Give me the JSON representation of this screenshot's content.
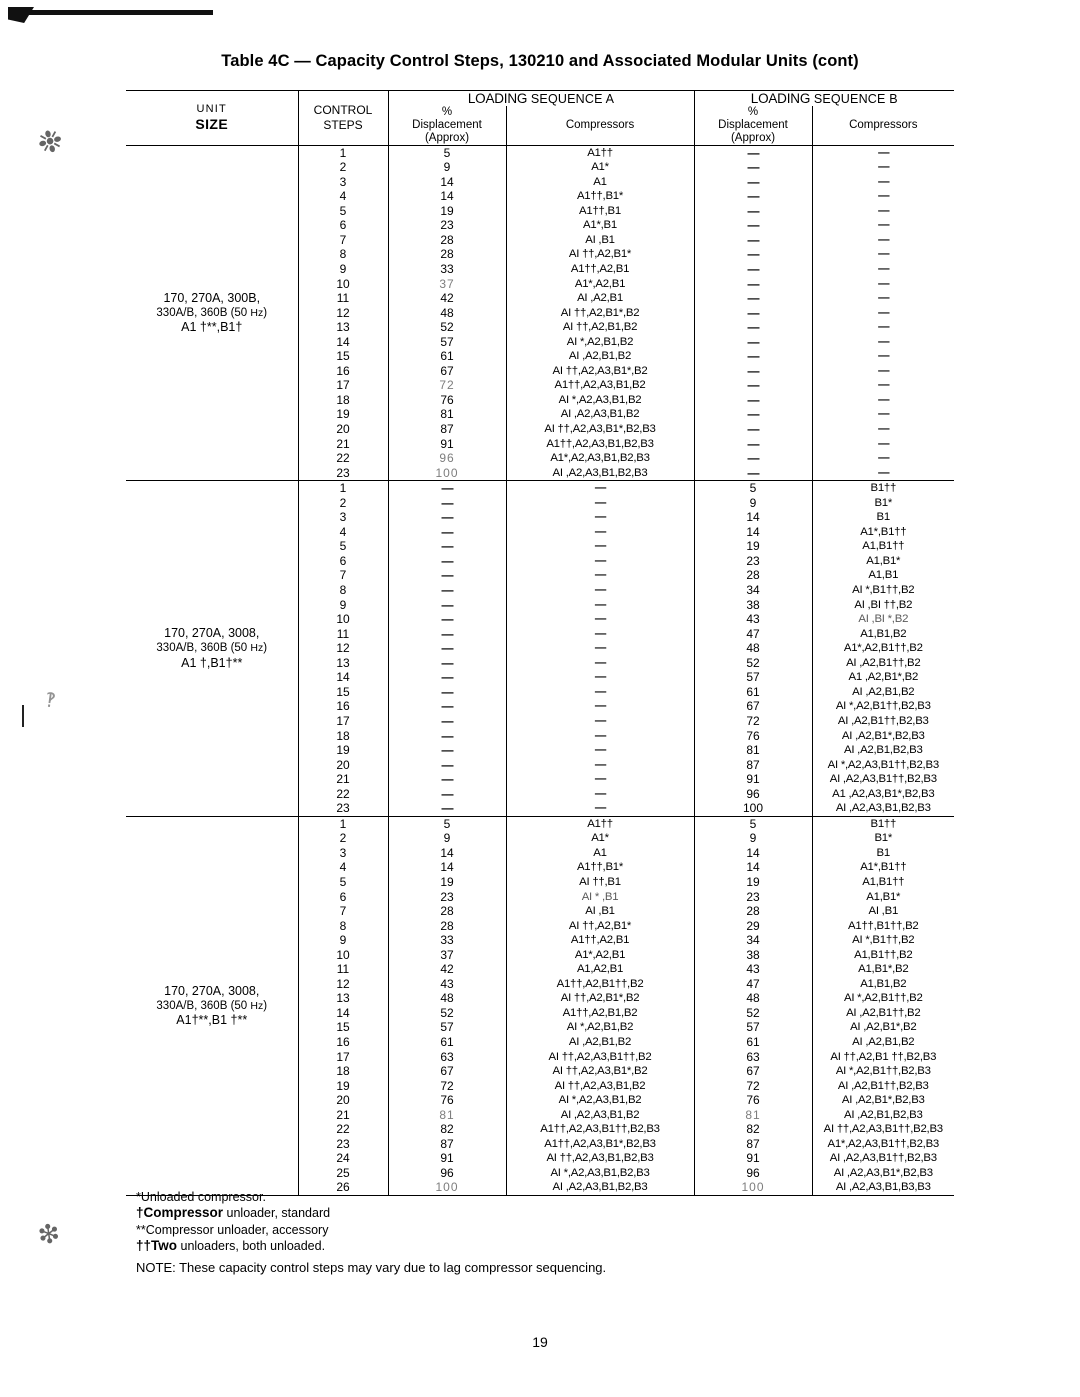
{
  "document": {
    "title_prefix": "Table 4C",
    "title_dash": "—",
    "title_text": "Capacity Control Steps, 130210 and Associated Modular Units",
    "title_suffix": "(cont)",
    "page_number": "19"
  },
  "header": {
    "unit_line1": "UNIT",
    "unit_line2": "SIZE",
    "control_line1": "CONTROL",
    "control_line2": "STEPS",
    "sequence_a_loading": "LOADING",
    "sequence_a_rest": "SEQUENCE A",
    "sequence_b_loading": "LOADING",
    "sequence_b_rest": "SEQUENCE B",
    "pct_line1": "%",
    "pct_line2": "Displacement",
    "pct_line3": "(Approx)",
    "compressors": "Compressors"
  },
  "footnotes": [
    {
      "marker": "*",
      "text": "Unloaded compressor."
    },
    {
      "marker": "†",
      "bold_word": "Compressor",
      "text": " unloader, standard"
    },
    {
      "marker": "**",
      "text": "Compressor  unloader,  accessory"
    },
    {
      "marker": "††",
      "bold_word": "Two",
      "text": " unloaders, both unloaded."
    }
  ],
  "note": "NOTE: These capacity control steps may vary due to lag compressor sequencing.",
  "blocks": [
    {
      "unit_size_lines": [
        "170, 270A, 300B,",
        "330A/B, 360B (50 Hz)",
        "A1 †**,B1†"
      ],
      "rows": [
        {
          "step": "1",
          "a_pct": "5",
          "a_comp": "A1††",
          "b_pct": "—",
          "b_comp": "—"
        },
        {
          "step": "2",
          "a_pct": "9",
          "a_comp": "A1*",
          "b_pct": "—",
          "b_comp": "—"
        },
        {
          "step": "3",
          "a_pct": "14",
          "a_comp": "A1",
          "b_pct": "—",
          "b_comp": "—"
        },
        {
          "step": "4",
          "a_pct": "14",
          "a_comp": "A1††,B1*",
          "b_pct": "—",
          "b_comp": "—"
        },
        {
          "step": "5",
          "a_pct": "19",
          "a_comp": "A1††,B1",
          "b_pct": "—",
          "b_comp": "—"
        },
        {
          "step": "6",
          "a_pct": "23",
          "a_comp": "A1*,B1",
          "b_pct": "—",
          "b_comp": "—"
        },
        {
          "step": "7",
          "a_pct": "28",
          "a_comp": "AI ,B1",
          "b_pct": "—",
          "b_comp": "—"
        },
        {
          "step": "8",
          "a_pct": "28",
          "a_comp": "AI ††,A2,B1*",
          "b_pct": "—",
          "b_comp": "—"
        },
        {
          "step": "9",
          "a_pct": "33",
          "a_comp": "A1††,A2,B1",
          "b_pct": "—",
          "b_comp": "—"
        },
        {
          "step": "10",
          "a_pct": "37",
          "a_comp": "A1*,A2,B1",
          "b_pct": "—",
          "b_comp": "—",
          "pct_faded": true
        },
        {
          "step": "11",
          "a_pct": "42",
          "a_comp": "AI ,A2,B1",
          "b_pct": "—",
          "b_comp": "—"
        },
        {
          "step": "12",
          "a_pct": "48",
          "a_comp": "AI ††,A2,B1*,B2",
          "b_pct": "—",
          "b_comp": "—"
        },
        {
          "step": "13",
          "a_pct": "52",
          "a_comp": "AI ††,A2,B1,B2",
          "b_pct": "—",
          "b_comp": "—"
        },
        {
          "step": "14",
          "a_pct": "57",
          "a_comp": "AI *,A2,B1,B2",
          "b_pct": "—",
          "b_comp": "—"
        },
        {
          "step": "15",
          "a_pct": "61",
          "a_comp": "AI ,A2,B1,B2",
          "b_pct": "—",
          "b_comp": "—"
        },
        {
          "step": "16",
          "a_pct": "67",
          "a_comp": "AI ††,A2,A3,B1*,B2",
          "b_pct": "—",
          "b_comp": "—"
        },
        {
          "step": "17",
          "a_pct": "72",
          "a_comp": "A1††,A2,A3,B1,B2",
          "b_pct": "—",
          "b_comp": "—",
          "pct_faded": true
        },
        {
          "step": "18",
          "a_pct": "76",
          "a_comp": "AI *,A2,A3,B1,B2",
          "b_pct": "—",
          "b_comp": "—"
        },
        {
          "step": "19",
          "a_pct": "81",
          "a_comp": "AI ,A2,A3,B1,B2",
          "b_pct": "—",
          "b_comp": "—"
        },
        {
          "step": "20",
          "a_pct": "87",
          "a_comp": "AI ††,A2,A3,B1*,B2,B3",
          "b_pct": "—",
          "b_comp": "—"
        },
        {
          "step": "21",
          "a_pct": "91",
          "a_comp": "A1††,A2,A3,B1,B2,B3",
          "b_pct": "—",
          "b_comp": "—"
        },
        {
          "step": "22",
          "a_pct": "96",
          "a_comp": "A1*,A2,A3,B1,B2,B3",
          "b_pct": "—",
          "b_comp": "—",
          "pct_faded": true
        },
        {
          "step": "23",
          "a_pct": "100",
          "a_comp": "AI ,A2,A3,B1,B2,B3",
          "b_pct": "—",
          "b_comp": "—",
          "pct_faded": true
        }
      ]
    },
    {
      "unit_size_lines": [
        "170, 270A, 3008,",
        "330A/B, 360B (50 Hz)",
        "A1 †,B1†**"
      ],
      "rows": [
        {
          "step": "1",
          "a_pct": "—",
          "a_comp": "—",
          "b_pct": "5",
          "b_comp": "B1††"
        },
        {
          "step": "2",
          "a_pct": "—",
          "a_comp": "—",
          "b_pct": "9",
          "b_comp": "B1*"
        },
        {
          "step": "3",
          "a_pct": "—",
          "a_comp": "—",
          "b_pct": "14",
          "b_comp": "B1"
        },
        {
          "step": "4",
          "a_pct": "—",
          "a_comp": "—",
          "b_pct": "14",
          "b_comp": "A1*,B1††"
        },
        {
          "step": "5",
          "a_pct": "—",
          "a_comp": "—",
          "b_pct": "19",
          "b_comp": "A1,B1††"
        },
        {
          "step": "6",
          "a_pct": "—",
          "a_comp": "—",
          "b_pct": "23",
          "b_comp": "A1,B1*"
        },
        {
          "step": "7",
          "a_pct": "—",
          "a_comp": "—",
          "b_pct": "28",
          "b_comp": "A1,B1"
        },
        {
          "step": "8",
          "a_pct": "—",
          "a_comp": "—",
          "b_pct": "34",
          "b_comp": "AI *,B1††,B2"
        },
        {
          "step": "9",
          "a_pct": "—",
          "a_comp": "—",
          "b_pct": "38",
          "b_comp": "AI ,BI ††,B2"
        },
        {
          "step": "10",
          "a_pct": "—",
          "a_comp": "—",
          "b_pct": "43",
          "b_comp": "AI ,BI *,B2",
          "b_faded": true
        },
        {
          "step": "11",
          "a_pct": "—",
          "a_comp": "—",
          "b_pct": "47",
          "b_comp": "A1,B1,B2"
        },
        {
          "step": "12",
          "a_pct": "—",
          "a_comp": "—",
          "b_pct": "48",
          "b_comp": "A1*,A2,B1††,B2"
        },
        {
          "step": "13",
          "a_pct": "—",
          "a_comp": "—",
          "b_pct": "52",
          "b_comp": "AI ,A2,B1††,B2"
        },
        {
          "step": "14",
          "a_pct": "—",
          "a_comp": "—",
          "b_pct": "57",
          "b_comp": "A1 ,A2,B1*,B2"
        },
        {
          "step": "15",
          "a_pct": "—",
          "a_comp": "—",
          "b_pct": "61",
          "b_comp": "AI ,A2,B1,B2"
        },
        {
          "step": "16",
          "a_pct": "—",
          "a_comp": "—",
          "b_pct": "67",
          "b_comp": "AI *,A2,B1††,B2,B3"
        },
        {
          "step": "17",
          "a_pct": "—",
          "a_comp": "—",
          "b_pct": "72",
          "b_comp": "AI ,A2,B1††,B2,B3"
        },
        {
          "step": "18",
          "a_pct": "—",
          "a_comp": "—",
          "b_pct": "76",
          "b_comp": "AI ,A2,B1*,B2,B3"
        },
        {
          "step": "19",
          "a_pct": "—",
          "a_comp": "—",
          "b_pct": "81",
          "b_comp": "AI ,A2,B1,B2,B3"
        },
        {
          "step": "20",
          "a_pct": "—",
          "a_comp": "—",
          "b_pct": "87",
          "b_comp": "AI *,A2,A3,B1††,B2,B3"
        },
        {
          "step": "21",
          "a_pct": "—",
          "a_comp": "—",
          "b_pct": "91",
          "b_comp": "AI ,A2,A3,B1††,B2,B3"
        },
        {
          "step": "22",
          "a_pct": "—",
          "a_comp": "—",
          "b_pct": "96",
          "b_comp": "A1 ,A2,A3,B1*,B2,B3"
        },
        {
          "step": "23",
          "a_pct": "—",
          "a_comp": "—",
          "b_pct": "100",
          "b_comp": "AI ,A2,A3,B1,B2,B3"
        }
      ]
    },
    {
      "unit_size_lines": [
        "170, 270A, 3008,",
        "330A/B, 360B  (50 Hz)",
        "A1†**,B1 †**"
      ],
      "rows": [
        {
          "step": "1",
          "a_pct": "5",
          "a_comp": "A1††",
          "b_pct": "5",
          "b_comp": "B1††"
        },
        {
          "step": "2",
          "a_pct": "9",
          "a_comp": "A1*",
          "b_pct": "9",
          "b_comp": "B1*"
        },
        {
          "step": "3",
          "a_pct": "14",
          "a_comp": "A1",
          "b_pct": "14",
          "b_comp": "B1"
        },
        {
          "step": "4",
          "a_pct": "14",
          "a_comp": "A1††,B1*",
          "b_pct": "14",
          "b_comp": "A1*,B1††"
        },
        {
          "step": "5",
          "a_pct": "19",
          "a_comp": "AI ††,B1",
          "b_pct": "19",
          "b_comp": "A1,B1††"
        },
        {
          "step": "6",
          "a_pct": "23",
          "a_comp": "AI * ,B1",
          "b_pct": "23",
          "b_comp": "A1,B1*",
          "a_faded": true
        },
        {
          "step": "7",
          "a_pct": "28",
          "a_comp": "AI ,B1",
          "b_pct": "28",
          "b_comp": "AI ,B1"
        },
        {
          "step": "8",
          "a_pct": "28",
          "a_comp": "AI ††,A2,B1*",
          "b_pct": "29",
          "b_comp": "A1††,B1††,B2"
        },
        {
          "step": "9",
          "a_pct": "33",
          "a_comp": "A1††,A2,B1",
          "b_pct": "34",
          "b_comp": "AI *,B1††,B2"
        },
        {
          "step": "10",
          "a_pct": "37",
          "a_comp": "A1*,A2,B1",
          "b_pct": "38",
          "b_comp": "A1,B1††,B2"
        },
        {
          "step": "11",
          "a_pct": "42",
          "a_comp": "A1,A2,B1",
          "b_pct": "43",
          "b_comp": "A1,B1*,B2"
        },
        {
          "step": "12",
          "a_pct": "43",
          "a_comp": "A1††,A2,B1††,B2",
          "b_pct": "47",
          "b_comp": "A1,B1,B2"
        },
        {
          "step": "13",
          "a_pct": "48",
          "a_comp": "AI ††,A2,B1*,B2",
          "b_pct": "48",
          "b_comp": "AI *,A2,B1††,B2"
        },
        {
          "step": "14",
          "a_pct": "52",
          "a_comp": "A1††,A2,B1,B2",
          "b_pct": "52",
          "b_comp": "AI ,A2,B1††,B2"
        },
        {
          "step": "15",
          "a_pct": "57",
          "a_comp": "AI *,A2,B1,B2",
          "b_pct": "57",
          "b_comp": "AI ,A2,B1*,B2"
        },
        {
          "step": "16",
          "a_pct": "61",
          "a_comp": "AI ,A2,B1,B2",
          "b_pct": "61",
          "b_comp": "AI ,A2,B1,B2"
        },
        {
          "step": "17",
          "a_pct": "63",
          "a_comp": "AI ††,A2,A3,B1††,B2",
          "b_pct": "63",
          "b_comp": "AI ††,A2,B1 ††,B2,B3"
        },
        {
          "step": "18",
          "a_pct": "67",
          "a_comp": "AI ††,A2,A3,B1*,B2",
          "b_pct": "67",
          "b_comp": "AI *,A2,B1††,B2,B3"
        },
        {
          "step": "19",
          "a_pct": "72",
          "a_comp": "AI ††,A2,A3,B1,B2",
          "b_pct": "72",
          "b_comp": "AI ,A2,B1††,B2,B3"
        },
        {
          "step": "20",
          "a_pct": "76",
          "a_comp": "AI *,A2,A3,B1,B2",
          "b_pct": "76",
          "b_comp": "AI ,A2,B1*,B2,B3"
        },
        {
          "step": "21",
          "a_pct": "81",
          "a_comp": "AI ,A2,A3,B1,B2",
          "b_pct": "81",
          "b_comp": "AI ,A2,B1,B2,B3",
          "pct_faded": true
        },
        {
          "step": "22",
          "a_pct": "82",
          "a_comp": "A1††,A2,A3,B1††,B2,B3",
          "b_pct": "82",
          "b_comp": "AI ††,A2,A3,B1††,B2,B3"
        },
        {
          "step": "23",
          "a_pct": "87",
          "a_comp": "A1††,A2,A3,B1*,B2,B3",
          "b_pct": "87",
          "b_comp": "A1*,A2,A3,B1††,B2,B3"
        },
        {
          "step": "24",
          "a_pct": "91",
          "a_comp": "AI ††,A2,A3,B1,B2,B3",
          "b_pct": "91",
          "b_comp": "AI ,A2,A3,B1††,B2,B3"
        },
        {
          "step": "25",
          "a_pct": "96",
          "a_comp": "AI *,A2,A3,B1,B2,B3",
          "b_pct": "96",
          "b_comp": "AI ,A2,A3,B1*,B2,B3"
        },
        {
          "step": "26",
          "a_pct": "100",
          "a_comp": "AI ,A2,A3,B1,B2,B3",
          "b_pct": "100",
          "b_comp": "AI ,A2,A3,B1,B3,B3",
          "pct_faded": true
        }
      ]
    }
  ]
}
